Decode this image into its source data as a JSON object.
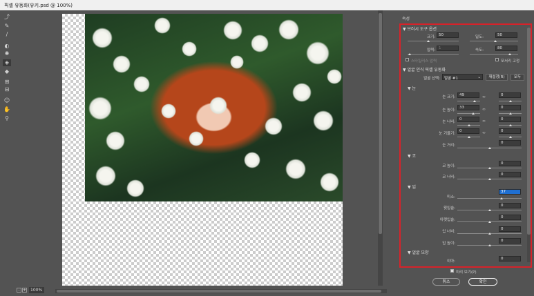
{
  "window": {
    "title": "픽셀 유동화(유키.psd @ 100%)"
  },
  "tools": [
    {
      "icon": "forward-warp-icon",
      "glyph": "⤴"
    },
    {
      "icon": "reconstruct-icon",
      "glyph": "✎"
    },
    {
      "icon": "smooth-icon",
      "glyph": "∕"
    },
    {
      "icon": "twirl-icon",
      "glyph": "◐"
    },
    {
      "icon": "pucker-icon",
      "glyph": "✺"
    },
    {
      "icon": "bloat-icon",
      "glyph": "◈"
    },
    {
      "icon": "push-left-icon",
      "glyph": "◆"
    },
    {
      "icon": "freeze-mask-icon",
      "glyph": "⊞"
    },
    {
      "icon": "thaw-mask-icon",
      "glyph": "⊟"
    },
    {
      "icon": "face-tool-icon",
      "glyph": "☺"
    },
    {
      "icon": "hand-icon",
      "glyph": "✋"
    },
    {
      "icon": "zoom-icon",
      "glyph": "⚲"
    }
  ],
  "status": {
    "zoom": "100%",
    "minus": "-",
    "plus": "+"
  },
  "panel": {
    "title": "속성",
    "brush": {
      "header": "▼ 브러시 도구 옵션",
      "size_label": "크기:",
      "size": "50",
      "density_label": "밀도:",
      "density": "50",
      "pressure_label": "압력:",
      "pressure": "1",
      "rate_label": "속도:",
      "rate": "80",
      "stylus_label": "스타일러스 압력",
      "pin_edges_label": "모서리 고정"
    },
    "face": {
      "header": "▼ 얼굴 인식 픽셀 유동화",
      "select_label": "얼굴 선택:",
      "select_value": "얼굴 #1",
      "reset_label": "재설정(R)",
      "all_label": "모두",
      "eyes_header": "▼ 눈",
      "eye_size_label": "눈 크기:",
      "eye_size_l": "49",
      "eye_size_r": "0",
      "eye_height_label": "눈 높이:",
      "eye_height_l": "33",
      "eye_height_r": "0",
      "eye_width_label": "눈 너비:",
      "eye_width_l": "0",
      "eye_width_r": "0",
      "eye_tilt_label": "눈 기울기:",
      "eye_tilt_l": "0",
      "eye_tilt_r": "0",
      "eye_distance_label": "눈 거리:",
      "eye_distance": "0",
      "nose_header": "▼ 코",
      "nose_height_label": "코 높이:",
      "nose_height": "0",
      "nose_width_label": "코 너비:",
      "nose_width": "0",
      "mouth_header": "▼ 입",
      "smile_label": "미소:",
      "smile": "37",
      "upper_lip_label": "윗입술:",
      "upper_lip": "0",
      "lower_lip_label": "아랫입술:",
      "lower_lip": "0",
      "mouth_width_label": "입 너비:",
      "mouth_width": "0",
      "mouth_height_label": "입 높이:",
      "mouth_height": "0",
      "face_shape_header": "▼ 얼굴 모양",
      "forehead_label": "이마:",
      "forehead": "0"
    },
    "preview_label": "미리 보기(P)",
    "cancel_label": "취소",
    "ok_label": "확인"
  },
  "colors": {
    "accent": "#1f6fd1",
    "highlight_border": "#d8222a"
  }
}
